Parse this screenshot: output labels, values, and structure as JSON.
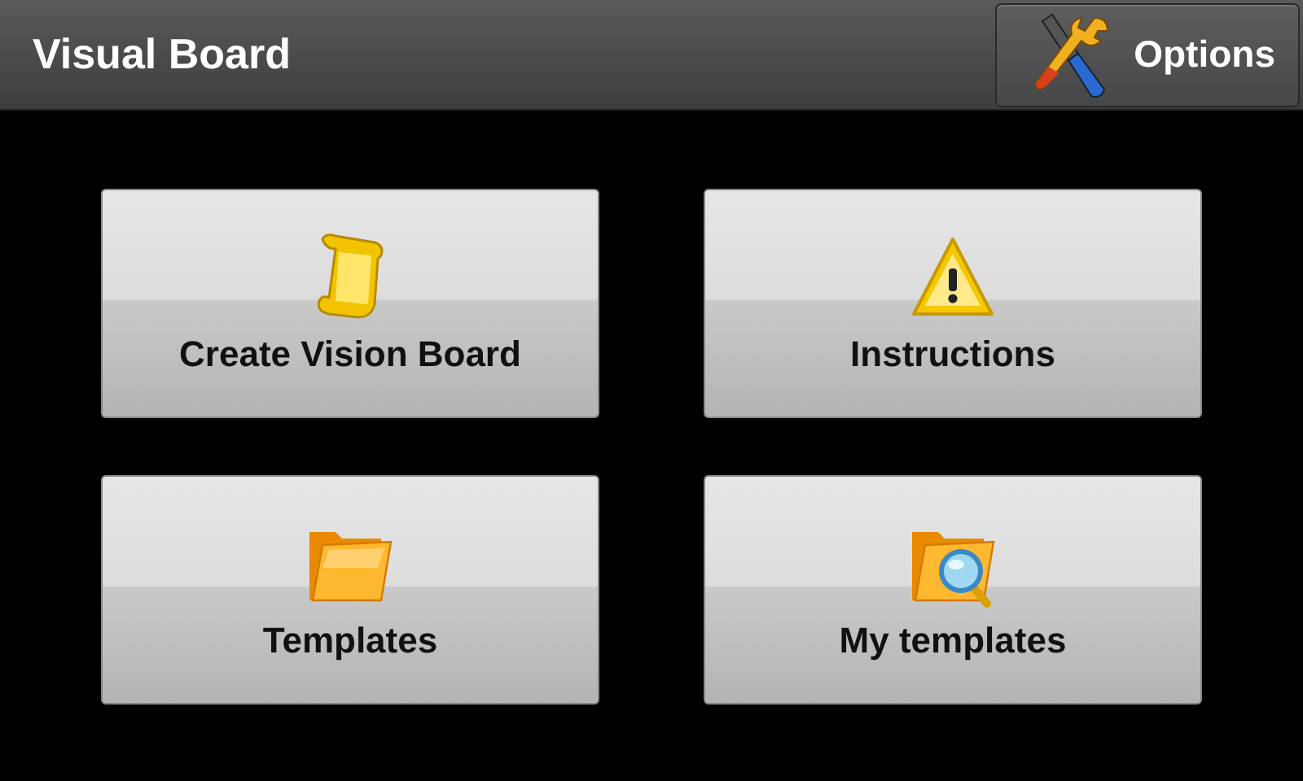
{
  "header": {
    "title": "Visual Board",
    "options_button": {
      "label": "Options"
    }
  },
  "tiles": [
    {
      "kind": "scroll",
      "label": "Create Vision Board"
    },
    {
      "kind": "warning",
      "label": "Instructions"
    },
    {
      "kind": "folder",
      "label": "Templates"
    },
    {
      "kind": "folder-search",
      "label": "My templates"
    }
  ]
}
